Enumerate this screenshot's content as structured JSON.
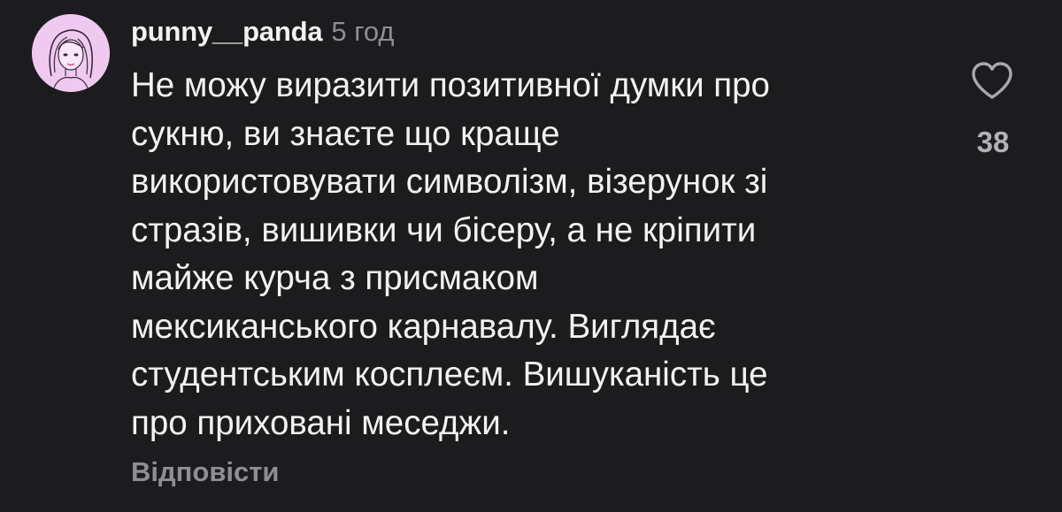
{
  "comment": {
    "username": "punny__panda",
    "timestamp": "5 год",
    "text": "Не можу виразити позитивної думки про\nсукню, ви знаєте що краще\nвикористовувати символізм, візерунок зі\nстразів, вишивки чи бісеру,  а не кріпити\nмайже курча з присмаком\nмексиканського карнавалу. Виглядає\nстудентським косплеєм. Вишуканість це\nпро приховані меседжи.",
    "reply_label": "Відповісти",
    "like_count": "38",
    "like_icon": "heart-outline-icon"
  },
  "colors": {
    "background": "#1c1c1e",
    "text_primary": "#f2f2f2",
    "text_secondary": "#8e8e93",
    "avatar_bg": "#f0c9f0"
  }
}
